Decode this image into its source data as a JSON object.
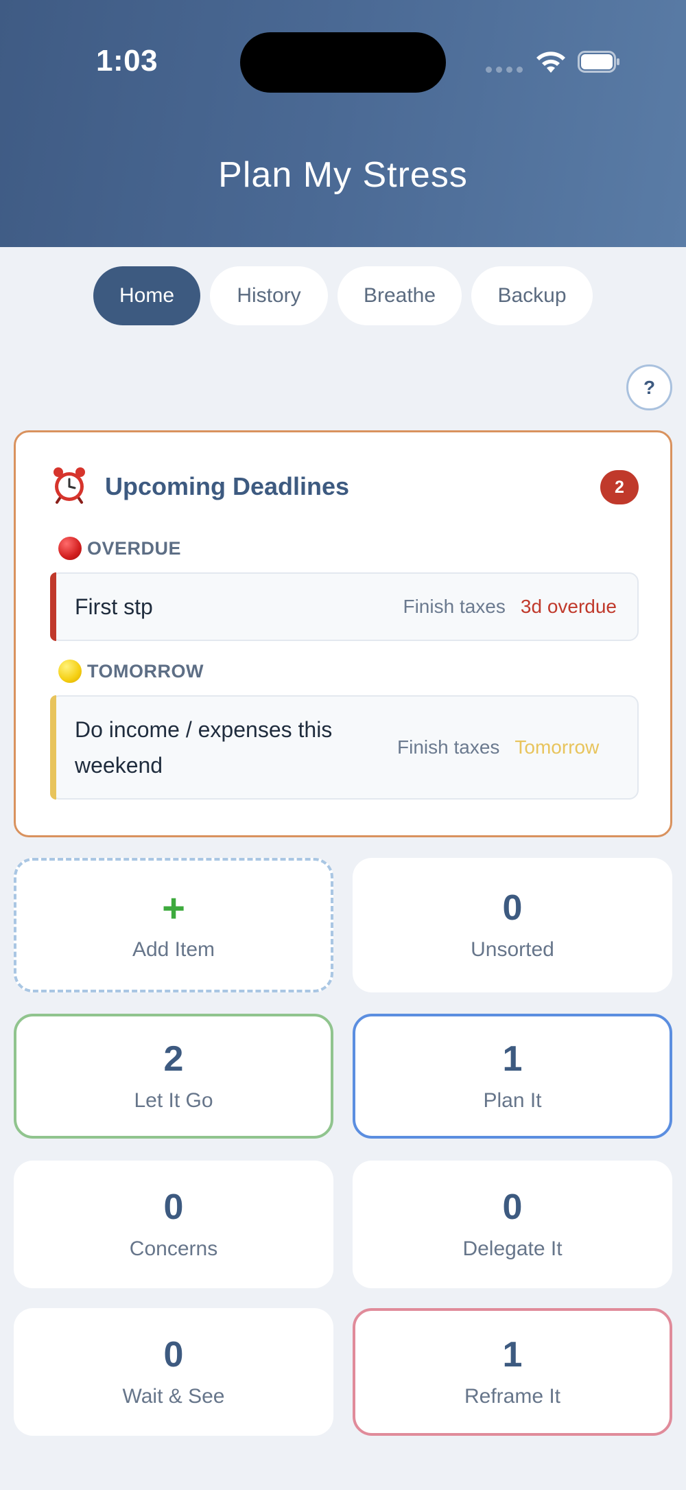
{
  "status_bar": {
    "time": "1:03"
  },
  "app": {
    "title": "Plan My Stress"
  },
  "tabs": [
    {
      "label": "Home",
      "active": true
    },
    {
      "label": "History",
      "active": false
    },
    {
      "label": "Breathe",
      "active": false
    },
    {
      "label": "Backup",
      "active": false
    }
  ],
  "help": {
    "label": "?"
  },
  "deadlines": {
    "title": "Upcoming Deadlines",
    "count": "2",
    "groups": [
      {
        "label": "OVERDUE",
        "items": [
          {
            "name": "First stp",
            "project": "Finish taxes",
            "due": "3d overdue",
            "color": "#c0392b"
          }
        ]
      },
      {
        "label": "TOMORROW",
        "items": [
          {
            "name": "Do income / expenses this weekend",
            "project": "Finish taxes",
            "due": "Tomorrow",
            "color": "#e8c45c"
          }
        ]
      }
    ]
  },
  "cards": {
    "add": {
      "icon": "+",
      "label": "Add Item"
    },
    "unsorted": {
      "count": "0",
      "label": "Unsorted"
    },
    "let_it_go": {
      "count": "2",
      "label": "Let It Go",
      "color": "#90c48e"
    },
    "plan_it": {
      "count": "1",
      "label": "Plan It",
      "color": "#5b8ee0"
    },
    "concerns": {
      "count": "0",
      "label": "Concerns"
    },
    "delegate_it": {
      "count": "0",
      "label": "Delegate It"
    },
    "wait_see": {
      "count": "0",
      "label": "Wait & See"
    },
    "reframe_it": {
      "count": "1",
      "label": "Reframe It",
      "color": "#e08b9a"
    }
  }
}
